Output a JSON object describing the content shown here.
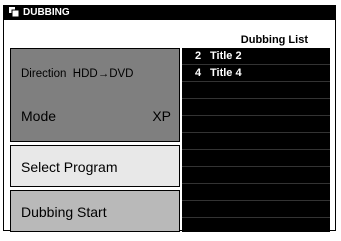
{
  "window": {
    "title": "DUBBING"
  },
  "settings": {
    "direction_label": "Direction",
    "direction_value": "HDD→DVD",
    "mode_label": "Mode",
    "mode_value": "XP"
  },
  "buttons": {
    "select_program": "Select Program",
    "dubbing_start": "Dubbing Start"
  },
  "dubbing_list": {
    "header": "Dubbing List",
    "rows": [
      {
        "num": "2",
        "title": "Title 2"
      },
      {
        "num": "4",
        "title": "Title 4"
      },
      {
        "num": "",
        "title": ""
      },
      {
        "num": "",
        "title": ""
      },
      {
        "num": "",
        "title": ""
      },
      {
        "num": "",
        "title": ""
      },
      {
        "num": "",
        "title": ""
      },
      {
        "num": "",
        "title": ""
      },
      {
        "num": "",
        "title": ""
      },
      {
        "num": "",
        "title": ""
      }
    ]
  },
  "colors": {
    "settings_bg": "#7f7f7f",
    "select_bg": "#e8e8e8",
    "start_bg": "#b9b9b9",
    "list_bg": "#000000"
  }
}
